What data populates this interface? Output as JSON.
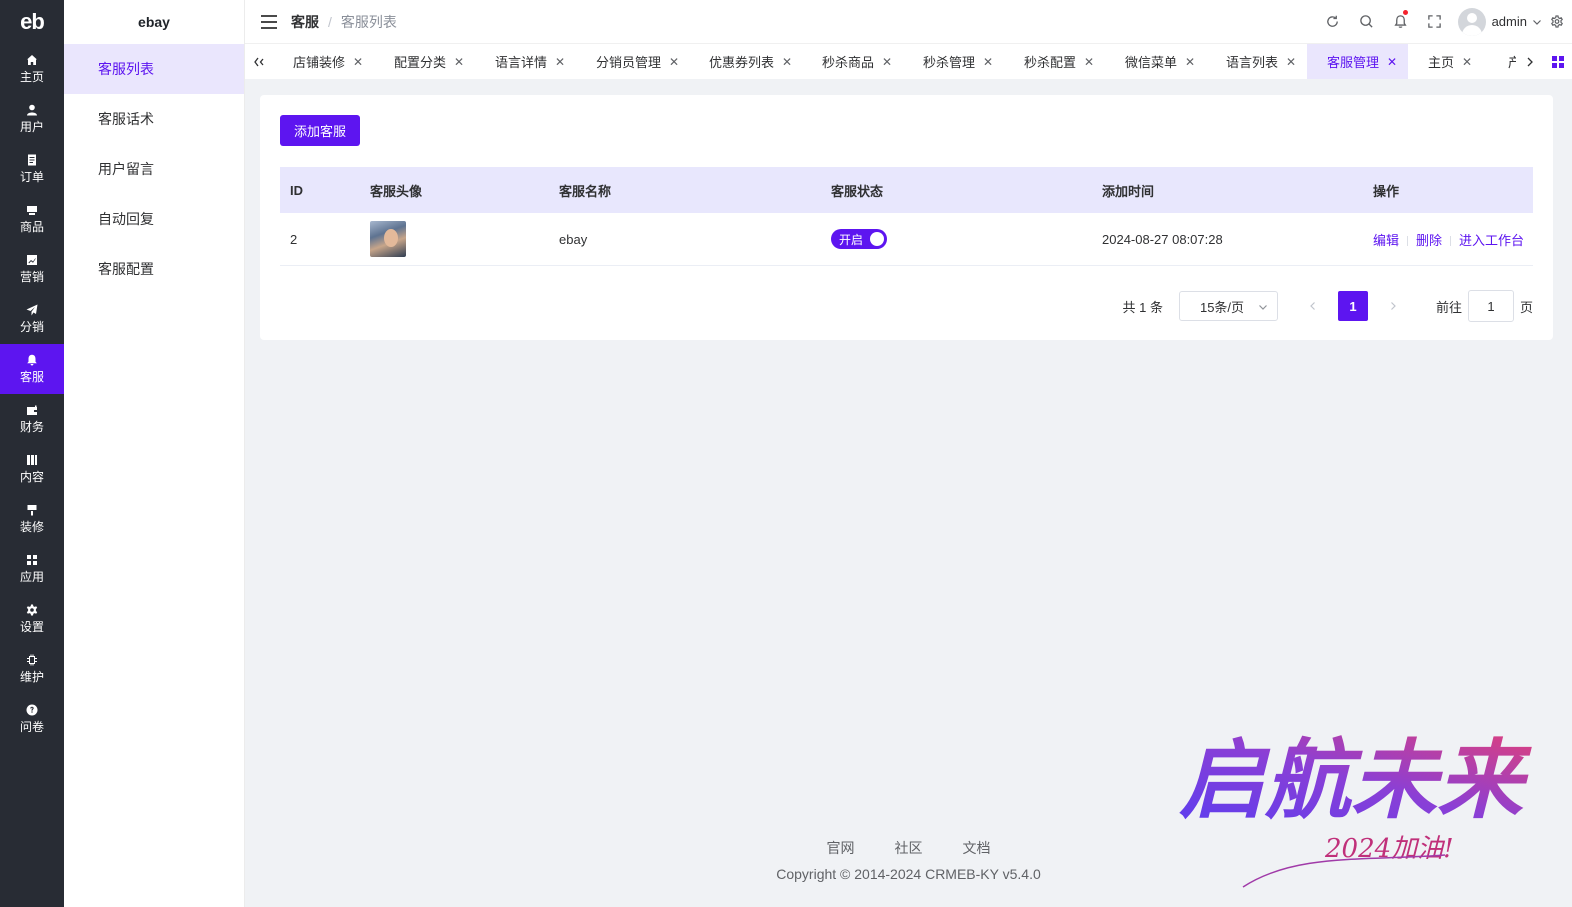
{
  "rail": {
    "logo": "eb",
    "items": [
      {
        "label": "主页",
        "icon": "home-icon"
      },
      {
        "label": "用户",
        "icon": "user-icon"
      },
      {
        "label": "订单",
        "icon": "order-icon"
      },
      {
        "label": "商品",
        "icon": "goods-icon"
      },
      {
        "label": "营销",
        "icon": "marketing-icon"
      },
      {
        "label": "分销",
        "icon": "send-icon"
      },
      {
        "label": "客服",
        "icon": "bell-icon"
      },
      {
        "label": "财务",
        "icon": "wallet-icon"
      },
      {
        "label": "内容",
        "icon": "content-icon"
      },
      {
        "label": "装修",
        "icon": "brush-icon"
      },
      {
        "label": "应用",
        "icon": "apps-icon"
      },
      {
        "label": "设置",
        "icon": "gear-icon"
      },
      {
        "label": "维护",
        "icon": "chip-icon"
      },
      {
        "label": "问卷",
        "icon": "question-icon"
      }
    ],
    "active_index": 6
  },
  "submenu": {
    "title": "ebay",
    "items": [
      "客服列表",
      "客服话术",
      "用户留言",
      "自动回复",
      "客服配置"
    ],
    "active_index": 0
  },
  "header": {
    "breadcrumb": [
      "客服",
      "客服列表"
    ],
    "separator": "/",
    "user": "admin",
    "notification_dot_color": "#f5222d"
  },
  "tabs": {
    "items": [
      "店铺装修",
      "配置分类",
      "语言详情",
      "分销员管理",
      "优惠券列表",
      "秒杀商品",
      "秒杀管理",
      "秒杀配置",
      "微信菜单",
      "语言列表",
      "客服管理",
      "主页",
      "产"
    ],
    "active_index": 10,
    "close_glyph": "✕"
  },
  "main": {
    "add_button": "添加客服",
    "table": {
      "columns": [
        "ID",
        "客服头像",
        "客服名称",
        "客服状态",
        "添加时间",
        "操作"
      ],
      "rows": [
        {
          "id": "2",
          "name": "ebay",
          "status": "开启",
          "status_on": true,
          "time": "2024-08-27 08:07:28",
          "actions": [
            "编辑",
            "删除",
            "进入工作台"
          ]
        }
      ]
    },
    "pagination": {
      "total": "共 1 条",
      "page_size": "15条/页",
      "current": "1",
      "goto_label": "前往",
      "goto_value": "1",
      "goto_suffix": "页"
    }
  },
  "footer": {
    "links": [
      "官网",
      "社区",
      "文档"
    ],
    "copyright": "Copyright © 2014-2024 CRMEB-KY v5.4.0"
  },
  "slogan": {
    "main": "启航未来",
    "sub": "2024加油!"
  },
  "colors": {
    "accent": "#5d15f0",
    "rail_bg": "#282c34",
    "highlight_bg": "#eae6fd"
  }
}
